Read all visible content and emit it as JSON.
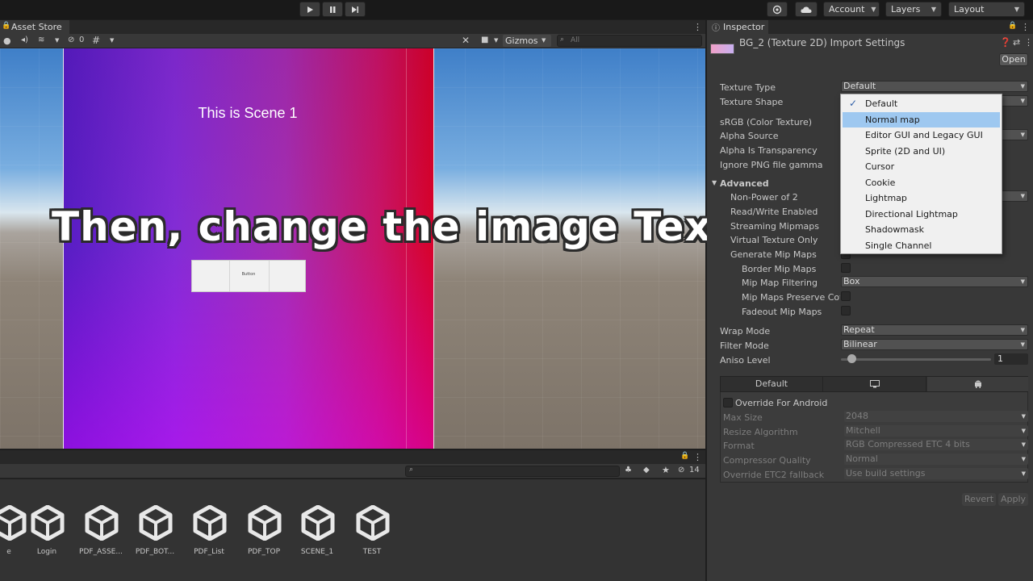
{
  "toolbar": {
    "play_icon": "play-icon",
    "pause_icon": "pause-icon",
    "step_icon": "step-icon",
    "account_label": "Account",
    "layers_label": "Layers",
    "layout_label": "Layout"
  },
  "scene_panel": {
    "tab_label": "Asset Store",
    "hidden_count": "0",
    "gizmos_label": "Gizmos",
    "search_placeholder": "All",
    "scene_title": "This is Scene 1",
    "button_label": "Button"
  },
  "caption": "Then, change the image Textur",
  "project_panel": {
    "hidden_count": "14",
    "assets": [
      "e",
      "Login",
      "PDF_ASSE...",
      "PDF_BOT...",
      "PDF_List",
      "PDF_TOP",
      "SCENE_1",
      "TEST"
    ]
  },
  "inspector": {
    "tab_label": "Inspector",
    "asset_title": "BG_2 (Texture 2D) Import Settings",
    "open_label": "Open",
    "rows": {
      "texture_type": "Texture Type",
      "texture_shape": "Texture Shape",
      "srgb": "sRGB (Color Texture)",
      "alpha_source": "Alpha Source",
      "alpha_transparency": "Alpha Is Transparency",
      "ignore_png": "Ignore PNG file gamma",
      "advanced": "Advanced",
      "non_power": "Non-Power of 2",
      "read_write": "Read/Write Enabled",
      "streaming": "Streaming Mipmaps",
      "virtual_texture": "Virtual Texture Only",
      "generate_mip": "Generate Mip Maps",
      "border_mip": "Border Mip Maps",
      "mip_filtering": "Mip Map Filtering",
      "mip_preserve": "Mip Maps Preserve Cove",
      "fadeout_mip": "Fadeout Mip Maps",
      "wrap_mode": "Wrap Mode",
      "filter_mode": "Filter Mode",
      "aniso_level": "Aniso Level"
    },
    "values": {
      "texture_type": "Default",
      "mip_filtering": "Box",
      "wrap_mode": "Repeat",
      "filter_mode": "Bilinear",
      "aniso_level": "1"
    },
    "platform_tabs": {
      "default_label": "Default",
      "monitor_icon": "monitor-icon",
      "android_icon": "android-icon"
    },
    "android": {
      "override_label": "Override For Android",
      "max_size_label": "Max Size",
      "max_size_value": "2048",
      "resize_label": "Resize Algorithm",
      "resize_value": "Mitchell",
      "format_label": "Format",
      "format_value": "RGB Compressed ETC 4 bits",
      "quality_label": "Compressor Quality",
      "quality_value": "Normal",
      "etc2_label": "Override ETC2 fallback",
      "etc2_value": "Use build settings"
    },
    "revert_label": "Revert",
    "apply_label": "Apply"
  },
  "dropdown": {
    "items": [
      "Default",
      "Normal map",
      "Editor GUI and Legacy GUI",
      "Sprite (2D and UI)",
      "Cursor",
      "Cookie",
      "Lightmap",
      "Directional Lightmap",
      "Shadowmask",
      "Single Channel"
    ],
    "checked_index": 0,
    "highlighted_index": 1
  }
}
